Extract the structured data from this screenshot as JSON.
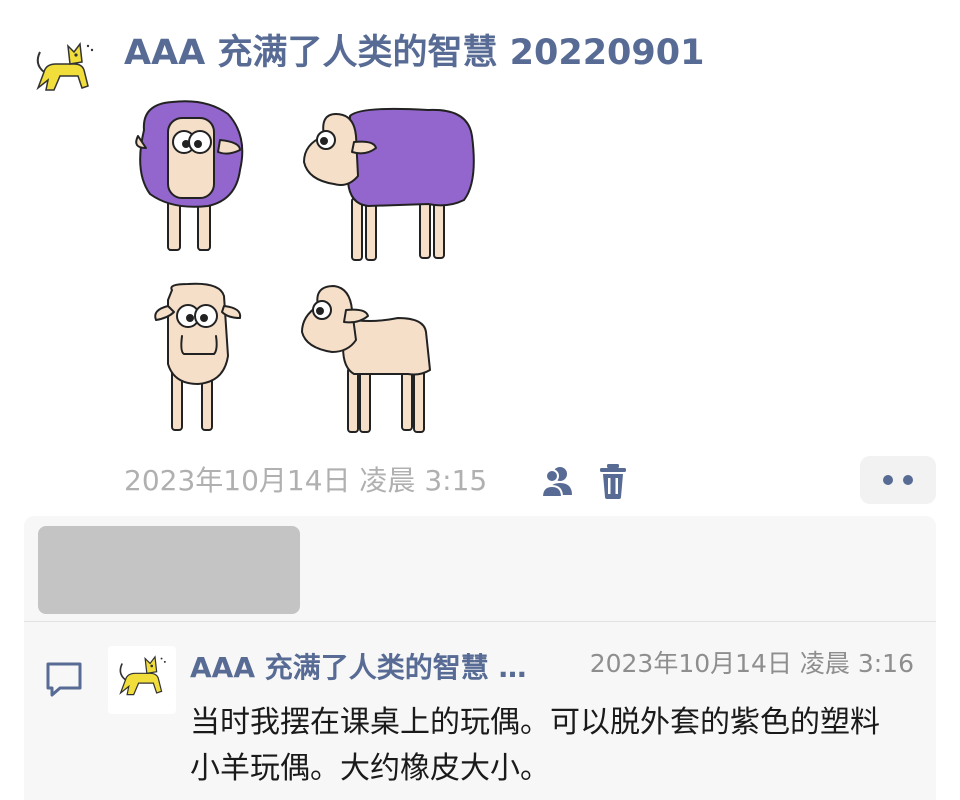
{
  "post": {
    "title": "AAA 充满了人类的智慧 20220901",
    "avatar_icon": "yellow-cat-icon",
    "image": "sheep-doll-drawings",
    "timestamp": "2023年10月14日 凌晨 3:15",
    "visibility_icon": "people-icon",
    "delete_icon": "trash-icon",
    "more_icon": "ellipsis-icon"
  },
  "comments": [
    {
      "icon": "comment-bubble-icon",
      "avatar_icon": "yellow-cat-icon",
      "author": "AAA 充满了人类的智慧 20220901",
      "time": "2023年10月14日 凌晨 3:16",
      "text": "当时我摆在课桌上的玩偶。可以脱外套的紫色的塑料小羊玩偶。大约橡皮大小。"
    }
  ],
  "colors": {
    "accent": "#576b95",
    "muted_text": "#b0b0b0",
    "comment_bg": "#f7f7f7",
    "sheep_purple": "#9266cc",
    "sheep_skin": "#f5dfc9",
    "cat_yellow": "#f2de3b"
  }
}
